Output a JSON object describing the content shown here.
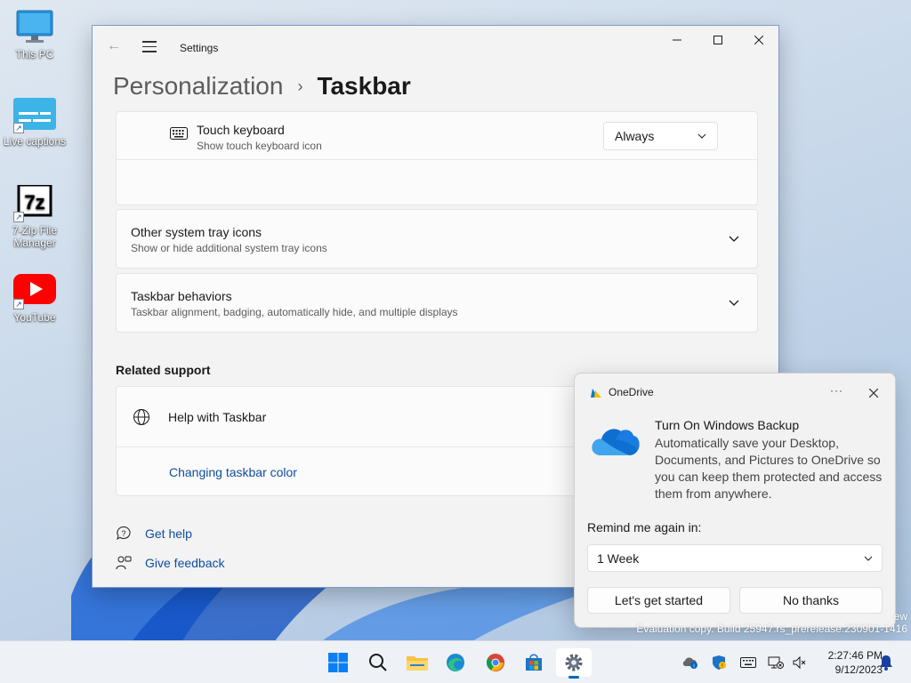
{
  "desktop": {
    "icons": [
      {
        "label": "This PC"
      },
      {
        "label": "Live captions"
      },
      {
        "label": "7-Zip File Manager"
      },
      {
        "label": "YouTube"
      }
    ],
    "watermark_line1": "ew",
    "watermark_line2": "Evaluation copy. Build 25947.rs_prerelease.230901-1416"
  },
  "settings": {
    "window_title": "Settings",
    "breadcrumb_parent": "Personalization",
    "breadcrumb_separator": "›",
    "breadcrumb_current": "Taskbar",
    "touch_keyboard": {
      "title": "Touch keyboard",
      "subtitle": "Show touch keyboard icon",
      "value": "Always"
    },
    "other_tray": {
      "title": "Other system tray icons",
      "subtitle": "Show or hide additional system tray icons"
    },
    "behaviors": {
      "title": "Taskbar behaviors",
      "subtitle": "Taskbar alignment, badging, automatically hide, and multiple displays"
    },
    "related_support": {
      "heading": "Related support",
      "help_title": "Help with Taskbar",
      "link": "Changing taskbar color"
    },
    "get_help": "Get help",
    "give_feedback": "Give feedback"
  },
  "onedrive": {
    "app_name": "OneDrive",
    "more_glyph": "···",
    "title": "Turn On Windows Backup",
    "body": "Automatically save your Desktop, Documents, and Pictures to OneDrive so you can keep them protected and access them from anywhere.",
    "remind_label": "Remind me again in:",
    "remind_value": "1 Week",
    "primary_button": "Let's get started",
    "secondary_button": "No thanks"
  },
  "taskbar": {
    "pinned": [
      "start-icon",
      "search-icon",
      "file-explorer-icon",
      "edge-icon",
      "chrome-icon",
      "store-icon",
      "settings-icon"
    ],
    "clock_time": "2:27:46 PM",
    "clock_date": "9/12/2023"
  },
  "colors": {
    "accent": "#0067c0",
    "link": "#0f4c9e",
    "window_bg": "#f3f3f3",
    "card_bg": "#fbfbfb"
  }
}
